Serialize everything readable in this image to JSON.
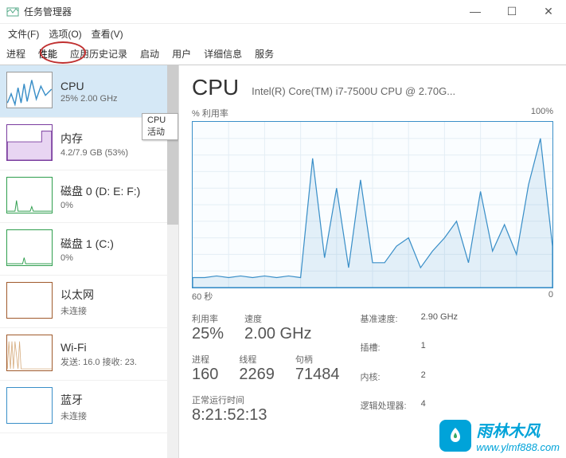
{
  "window": {
    "title": "任务管理器"
  },
  "menu": {
    "file": "文件(F)",
    "options": "选项(O)",
    "view": "查看(V)"
  },
  "tabs": {
    "processes": "进程",
    "performance": "性能",
    "app_history": "应用历史记录",
    "startup": "启动",
    "users": "用户",
    "details": "详细信息",
    "services": "服务"
  },
  "tooltip": "CPU 活动",
  "sidebar": [
    {
      "name": "CPU",
      "detail": "25%  2.00 GHz",
      "color": "#3a8fc8"
    },
    {
      "name": "内存",
      "detail": "4.2/7.9 GB (53%)",
      "color": "#7a3c9e"
    },
    {
      "name": "磁盘 0 (D: E: F:)",
      "detail": "0%",
      "color": "#2e9e4d"
    },
    {
      "name": "磁盘 1 (C:)",
      "detail": "0%",
      "color": "#2e9e4d"
    },
    {
      "name": "以太网",
      "detail": "未连接",
      "color": "#a05a2c"
    },
    {
      "name": "Wi-Fi",
      "detail": "发送: 16.0  接收: 23.",
      "color": "#a05a2c"
    },
    {
      "name": "蓝牙",
      "detail": "未连接",
      "color": "#3a8fc8"
    }
  ],
  "main": {
    "title": "CPU",
    "subtitle": "Intel(R) Core(TM) i7-7500U CPU @ 2.70G...",
    "y_label": "% 利用率",
    "y_max": "100%",
    "x_label": "60 秒",
    "x_right": "0",
    "stats": {
      "util_lbl": "利用率",
      "util_val": "25%",
      "speed_lbl": "速度",
      "speed_val": "2.00 GHz",
      "proc_lbl": "进程",
      "proc_val": "160",
      "thread_lbl": "线程",
      "thread_val": "2269",
      "handle_lbl": "句柄",
      "handle_val": "71484",
      "uptime_lbl": "正常运行时间",
      "uptime_val": "8:21:52:13"
    },
    "specs": {
      "base_lbl": "基准速度:",
      "base_val": "2.90 GHz",
      "sockets_lbl": "插槽:",
      "sockets_val": "1",
      "cores_lbl": "内核:",
      "cores_val": "2",
      "lps_lbl": "逻辑处理器:",
      "lps_val": "4"
    }
  },
  "watermark": {
    "cn": "雨林木风",
    "url": "www.ylmf888.com"
  },
  "chart_data": {
    "type": "line",
    "title": "CPU % 利用率",
    "xlabel": "60 秒",
    "ylabel": "% 利用率",
    "ylim": [
      0,
      100
    ],
    "x": [
      60,
      58,
      56,
      54,
      52,
      50,
      48,
      46,
      44,
      42,
      40,
      38,
      36,
      34,
      32,
      30,
      28,
      26,
      24,
      22,
      20,
      18,
      16,
      14,
      12,
      10,
      8,
      6,
      4,
      2,
      0
    ],
    "values": [
      6,
      6,
      7,
      6,
      7,
      6,
      7,
      6,
      7,
      6,
      78,
      18,
      60,
      12,
      65,
      15,
      15,
      25,
      30,
      12,
      22,
      30,
      40,
      15,
      58,
      22,
      38,
      20,
      62,
      90,
      25
    ]
  }
}
